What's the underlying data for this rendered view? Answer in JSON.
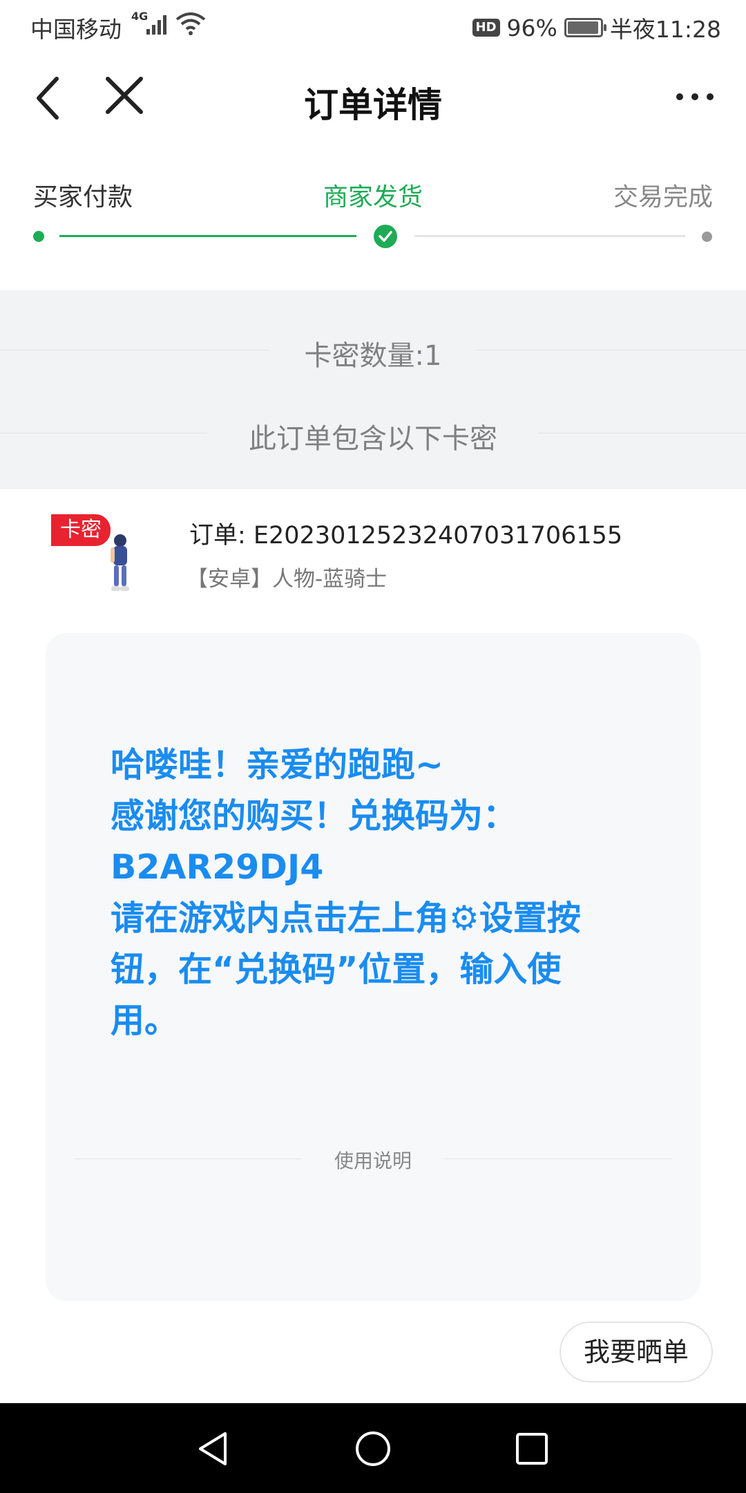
{
  "status_bar": {
    "carrier": "中国移动",
    "network": "4G",
    "hd": "HD",
    "battery": "96%",
    "time": "半夜11:28"
  },
  "nav": {
    "title": "订单详情"
  },
  "steps": {
    "items": [
      "买家付款",
      "商家发货",
      "交易完成"
    ],
    "current_index": 1
  },
  "card_info": {
    "count_label": "卡密数量:1",
    "contains_label": "此订单包含以下卡密"
  },
  "order": {
    "thumb_tag": "卡密",
    "order_no": "订单: E20230125232407031706155",
    "product_name": "【安卓】人物-蓝骑士",
    "message_lines": [
      "哈喽哇！亲爱的跑跑~",
      "感谢您的购买！兑换码为：",
      "B2AR29DJ4",
      "请在游戏内点击左上角⚙设置按",
      "钮，在“兑换码”位置，输入使",
      "用。"
    ],
    "usage_label": "使用说明",
    "share_button": "我要晒单"
  },
  "colors": {
    "accent_green": "#1fab55",
    "message_blue": "#1a8cf0",
    "tag_red": "#e8232f"
  }
}
